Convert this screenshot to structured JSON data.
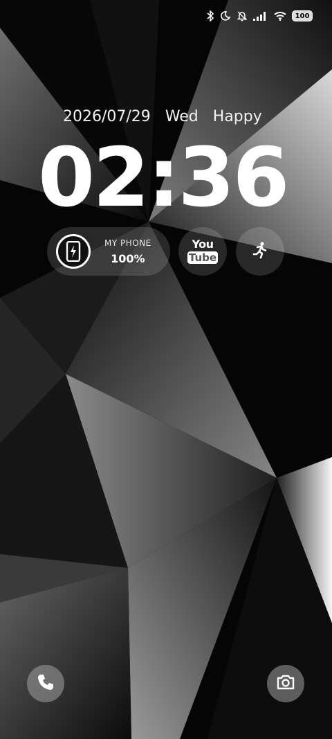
{
  "status_bar": {
    "icons": [
      "bluetooth-icon",
      "moon-icon",
      "bell-off-icon",
      "signal-icon",
      "wifi-icon"
    ],
    "battery_level": "100"
  },
  "lockscreen": {
    "date": "2026/07/29",
    "weekday": "Wed",
    "greeting": "Happy",
    "time": "02:36"
  },
  "widgets": {
    "battery_widget": {
      "label": "MY PHONE",
      "value": "100%",
      "icon": "phone-charging-icon"
    },
    "youtube": {
      "line1": "You",
      "line2": "Tube"
    },
    "running_icon": "running-person-icon"
  },
  "shortcuts": {
    "left_icon": "phone-icon",
    "right_icon": "camera-icon"
  },
  "colors": {
    "background": "#000000",
    "widget_bg": "rgba(255,255,255,0.14)",
    "text": "#ffffff"
  }
}
